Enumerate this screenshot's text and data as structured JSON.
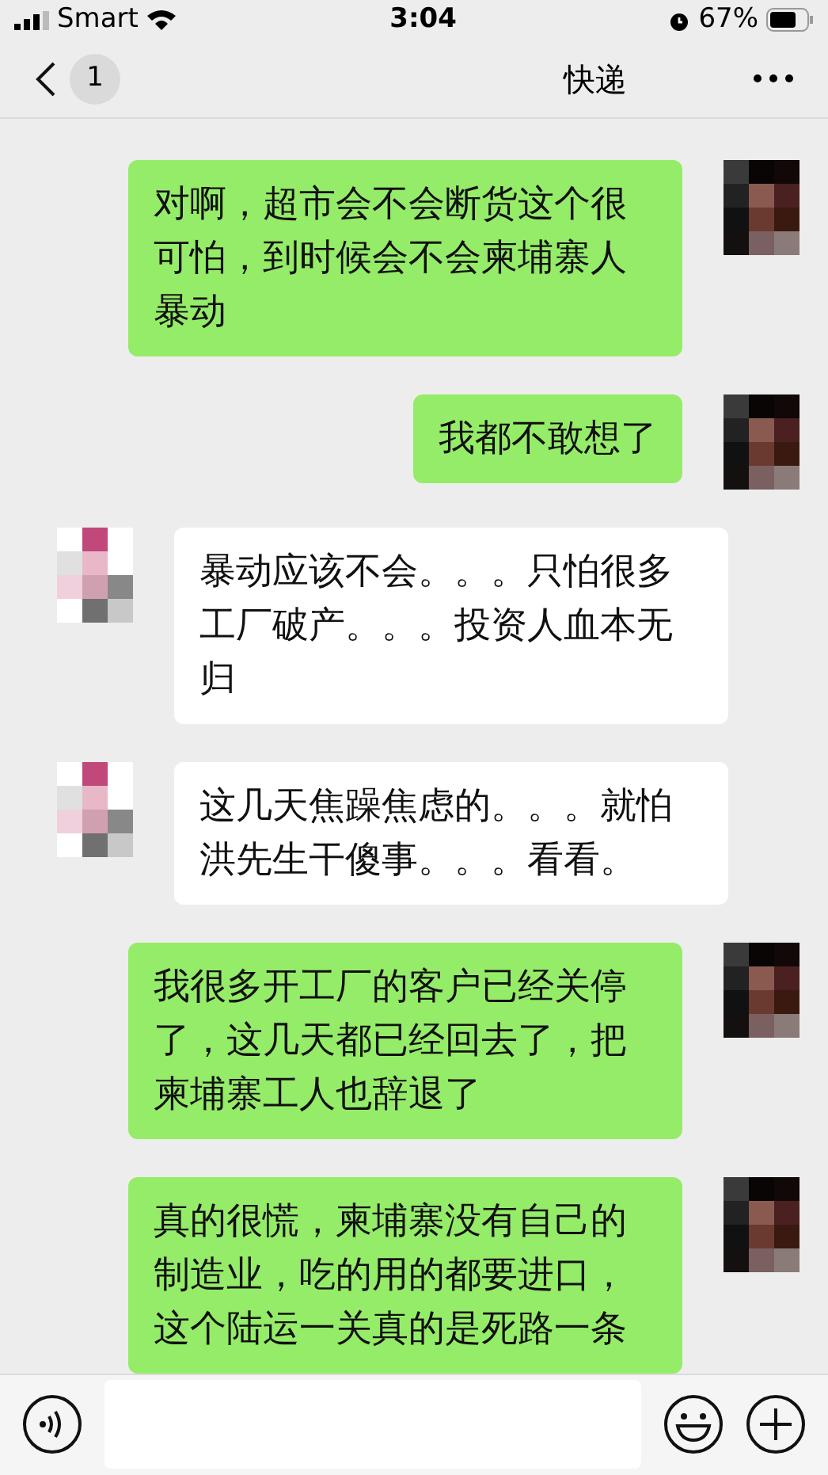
{
  "status_bar": {
    "carrier": "Smart",
    "time": "3:04",
    "battery": "67%"
  },
  "nav": {
    "unread": "1",
    "title": "快递"
  },
  "messages": [
    {
      "kind": "sent",
      "text": "对啊，超市会不会断货这个很可怕，到时候会不会柬埔寨人暴动"
    },
    {
      "kind": "sent",
      "text": "我都不敢想了"
    },
    {
      "kind": "received",
      "text": "暴动应该不会。。。只怕很多工厂破产。。。投资人血本无归"
    },
    {
      "kind": "received",
      "text": "这几天焦躁焦虑的。。。就怕洪先生干傻事。。。看看。"
    },
    {
      "kind": "sent",
      "text": "我很多开工厂的客户已经关停了，这几天都已经回去了，把柬埔寨工人也辞退了"
    },
    {
      "kind": "sent",
      "text": "真的很慌，柬埔寨没有自己的制造业，吃的用的都要进口，这个陆运一关真的是死路一条"
    }
  ]
}
